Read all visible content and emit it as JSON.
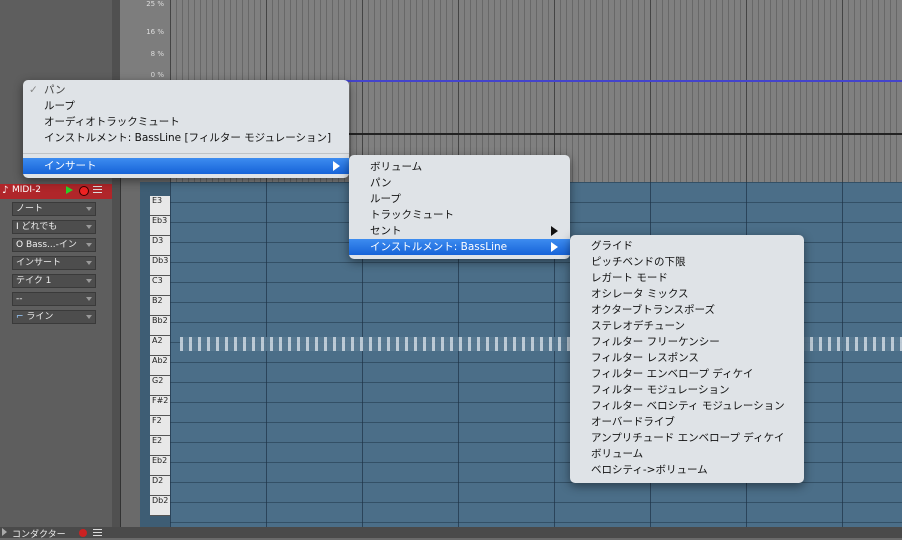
{
  "colors": {
    "accent": "#1e6fe0",
    "track_red": "#b0262a",
    "grid_blue": "#4b6e88"
  },
  "percent_labels": [
    "25 %",
    "16 %",
    "8 %",
    "0 %"
  ],
  "track": {
    "name": "MIDI-2"
  },
  "inspector": {
    "selects": [
      "ノート",
      "どれでも",
      "Bass...-イン",
      "インサート",
      "テイク 1",
      "--",
      "ライン"
    ]
  },
  "piano_keys": [
    "E3",
    "Eb3",
    "D3",
    "Db3",
    "C3",
    "B2",
    "Bb2",
    "A2",
    "Ab2",
    "G2",
    "F#2",
    "F2",
    "E2",
    "Eb2",
    "D2",
    "Db2"
  ],
  "bottom": {
    "label": "コンダクター"
  },
  "menu1": {
    "items": [
      "パン",
      "ループ",
      "オーディオトラックミュート",
      "インストルメント: BassLine [フィルター モジュレーション]"
    ],
    "checked_mark": "✓",
    "insert": "インサート"
  },
  "menu2": {
    "items": [
      "ボリューム",
      "パン",
      "ループ",
      "トラックミュート",
      "セント",
      "インストルメント: BassLine"
    ]
  },
  "menu3": {
    "items": [
      "グライド",
      "ピッチベンドの下限",
      "レガート モード",
      "オシレータ ミックス",
      "オクターブトランスポーズ",
      "ステレオデチューン",
      "フィルター フリーケンシー",
      "フィルター レスポンス",
      "フィルター エンベロープ ディケイ",
      "フィルター モジュレーション",
      "フィルター ベロシティ モジュレーション",
      "オーバードライブ",
      "アンプリチュード エンベロープ ディケイ",
      "ボリューム",
      "ベロシティ->ボリューム"
    ]
  }
}
